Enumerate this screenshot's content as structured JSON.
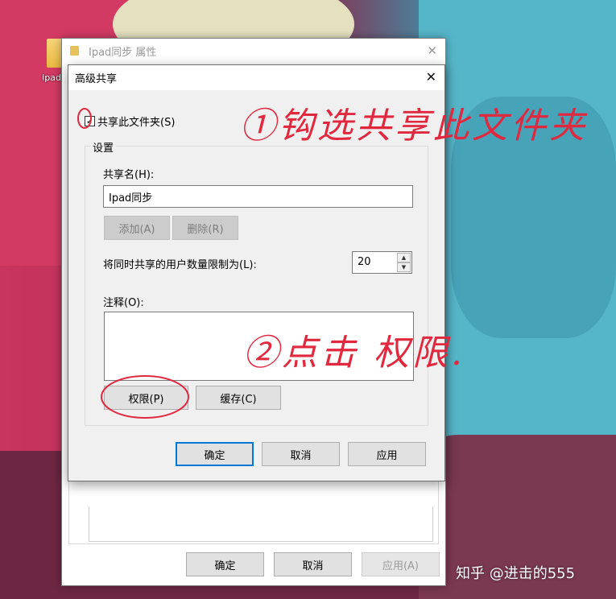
{
  "desktop": {
    "icon_label": "Ipad",
    "watermark": "知乎 @进击的555"
  },
  "properties_window": {
    "title": "Ipad同步 属性",
    "close_glyph": "✕",
    "buttons": {
      "ok": "确定",
      "cancel": "取消",
      "apply": "应用(A)"
    }
  },
  "dialog": {
    "title": "高级共享",
    "close_glyph": "✕",
    "share_checkbox": {
      "label": "共享此文件夹(S)",
      "checked": true,
      "check_glyph": "✓"
    },
    "settings": {
      "legend": "设置",
      "share_name_label": "共享名(H):",
      "share_name_value": "Ipad同步",
      "add_button": "添加(A)",
      "remove_button": "删除(R)",
      "limit_label": "将同时共享的用户数量限制为(L):",
      "limit_value": "20",
      "comment_label": "注释(O):",
      "comment_value": "",
      "permissions_button": "权限(P)",
      "caching_button": "缓存(C)"
    },
    "buttons": {
      "ok": "确定",
      "cancel": "取消",
      "apply": "应用"
    }
  },
  "annotations": {
    "step1": "①钩选共享此文件夹",
    "step2": "②点击 权限.",
    "color": "#e0283e"
  }
}
